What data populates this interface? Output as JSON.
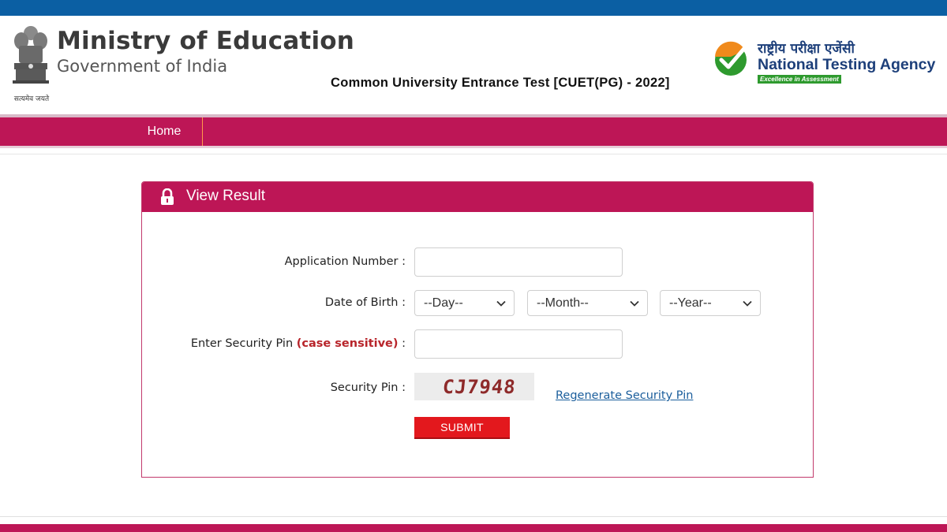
{
  "header": {
    "emblem_icon": "national-emblem-icon",
    "emblem_motto": "सत्यमेव जयते",
    "ministry_title": "Ministry of Education",
    "ministry_subtitle": "Government of India",
    "exam_title": "Common University Entrance Test [CUET(PG) - 2022]",
    "nta_logo_icon": "nta-checkmark-logo-icon",
    "nta_hindi": "राष्ट्रीय परीक्षा एजेंसी",
    "nta_english": "National Testing Agency",
    "nta_tagline": "Excellence in Assessment"
  },
  "nav": {
    "home": "Home"
  },
  "panel": {
    "title": "View Result",
    "icon": "lock-icon"
  },
  "form": {
    "application_number_label": "Application Number :",
    "application_number_value": "",
    "dob_label": "Date of Birth :",
    "day_selected": "--Day--",
    "month_selected": "--Month--",
    "year_selected": "--Year--",
    "security_pin_label_prefix": "Enter Security Pin",
    "security_pin_label_note": "(case sensitive)",
    "security_pin_label_suffix": ":",
    "security_pin_value": "",
    "captcha_label": "Security Pin :",
    "captcha_text": "CJ7948",
    "regenerate_link": "Regenerate Security Pin",
    "submit_label": "SUBMIT"
  },
  "colors": {
    "top_strip": "#0b5fa3",
    "brand_magenta": "#bd1656",
    "submit_red": "#e3181d",
    "link_blue": "#1b5e9c"
  }
}
